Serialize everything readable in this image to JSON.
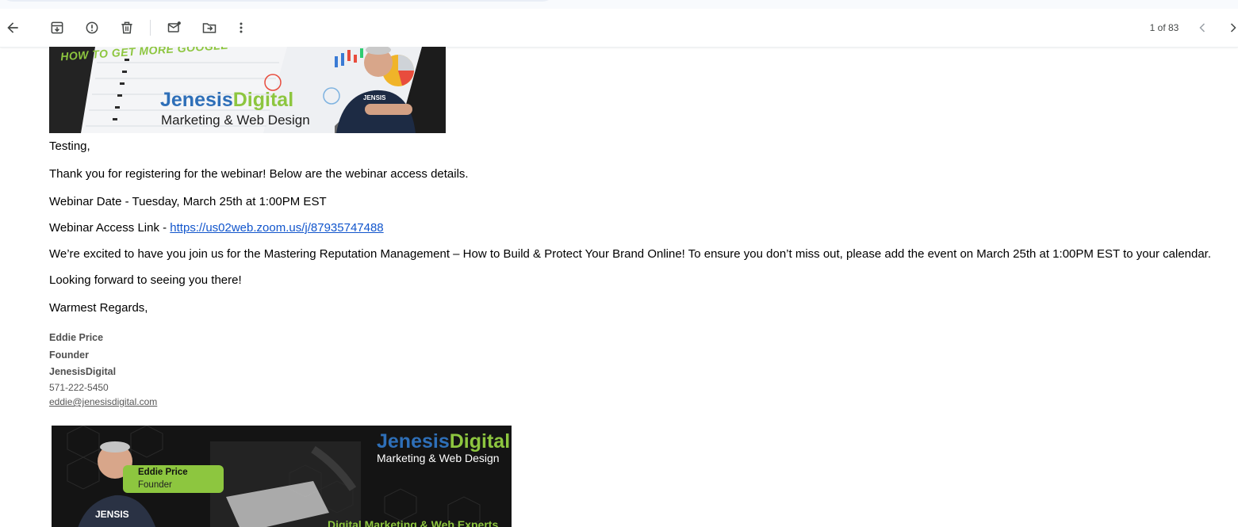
{
  "toolbar": {
    "buttons": [
      "back",
      "archive",
      "report-spam",
      "delete",
      "mark-unread",
      "move-to",
      "more"
    ],
    "pager": "1 of 83"
  },
  "email": {
    "banner_top": {
      "headline": "HOW TO GET MORE GOOGLE",
      "brand_part1": "Jenesis",
      "brand_part2": "Digital",
      "brand_tagline": "Marketing & Web Design",
      "shirt_text": "JENSIS"
    },
    "greeting": "Testing,",
    "intro": "Thank you for registering for the webinar! Below are the webinar access details.",
    "date_line": "Webinar Date - Tuesday, March 25th at 1:00PM EST",
    "link_label": "Webinar Access Link - ",
    "link_url": "https://us02web.zoom.us/j/87935747488",
    "body": "We’re excited to have you join us for the Mastering Reputation Management – How to Build & Protect Your Brand Online! To ensure you don’t miss out, please add the event on March 25th at 1:00PM EST to your calendar.",
    "closing1": "Looking forward to seeing you there!",
    "closing2": "Warmest Regards,",
    "signature": {
      "name": "Eddie Price",
      "title": "Founder",
      "company": "JenesisDigital",
      "phone": "571-222-5450",
      "email": "eddie@jenesisdigital.com"
    },
    "banner_bottom": {
      "brand_part1": "Jenesis",
      "brand_part2": "Digital",
      "brand_tagline": "Marketing & Web Design",
      "name": "Eddie Price",
      "title": "Founder",
      "footer_text": "Digital Marketing & Web Experts",
      "shirt_text": "JENSIS"
    }
  },
  "colors": {
    "link": "#1155cc",
    "brand_blue": "#2e6fb8",
    "brand_green": "#8dc63f",
    "toolbar_icon": "#444746"
  }
}
